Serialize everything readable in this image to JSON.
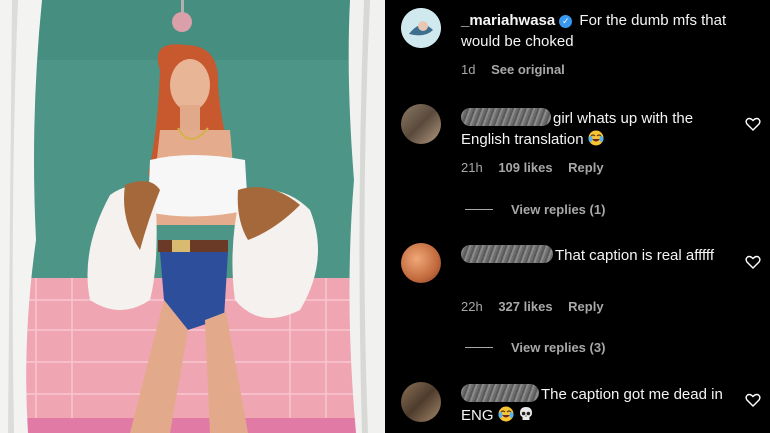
{
  "post": {
    "username": "_mariahwasa",
    "caption": "For the dumb mfs that would be choked",
    "time": "1d",
    "see_original": "See original"
  },
  "comments": [
    {
      "text": "girl whats up with the English translation",
      "emoji": "crying-laughing",
      "time": "21h",
      "likes": "109 likes",
      "reply": "Reply",
      "view_replies": "View replies (1)"
    },
    {
      "text": "That caption is real afffff",
      "time": "22h",
      "likes": "327 likes",
      "reply": "Reply",
      "view_replies": "View replies (3)"
    },
    {
      "text": "The caption got me dead in ENG",
      "emoji": "crying-laughing, skull"
    }
  ],
  "colors": {
    "background": "#000000",
    "verified": "#3897f0",
    "secondary_text": "#a8a8a8"
  }
}
